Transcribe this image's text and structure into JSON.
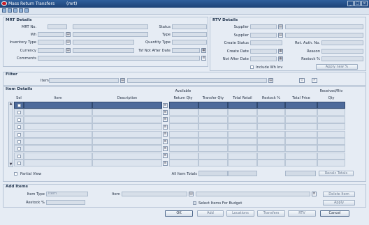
{
  "window": {
    "title": "Mass Return Transfers",
    "subtitle": "(mrt)",
    "min_glyph": "_",
    "max_glyph": "□",
    "close_glyph": "×"
  },
  "mrt_details": {
    "title": "MRT Details",
    "mrt_no_label": "MRT No.",
    "wh_label": "Wh",
    "inventory_type_label": "Inventory Type",
    "currency_label": "Currency",
    "comments_label": "Comments",
    "status_label": "Status",
    "type_label": "Type",
    "quantity_type_label": "Quantity Type",
    "tsf_not_after_date_label": "Tsf Not After Date"
  },
  "rtv_details": {
    "title": "RTV Details",
    "supplier_label_1": "Supplier",
    "supplier_label_2": "Supplier",
    "create_status_label": "Create Status",
    "create_date_label": "Create Date",
    "not_after_date_label": "Not After Date",
    "include_wh_inv_label": "Include Wh Inv",
    "ret_auth_no_label": "Ret. Auth. No.",
    "reason_label": "Reason",
    "restock_pct_label": "Restock %",
    "apply_new_pct_label": "Apply new %"
  },
  "filter": {
    "title": "Filter",
    "item_label": "Item"
  },
  "item_details": {
    "title": "Item Details",
    "columns": {
      "sel": "Sel",
      "item": "Item",
      "description": "Description",
      "available_return_qty_1": "Available",
      "available_return_qty_2": "Return Qty",
      "transfer_qty": "Transfer Qty",
      "total_retail": "Total Retail",
      "restock_pct": "Restock %",
      "total_price": "Total Price",
      "received_rtv_qty_1": "Received/Rtv",
      "received_rtv_qty_2": "Qty"
    },
    "partial_view_label": "Partial View",
    "all_item_totals_label": "All Item Totals",
    "recalc_totals_label": "Recalc Totals"
  },
  "add_items": {
    "title": "Add Items",
    "item_type_label": "Item Type",
    "item_type_value": "Item",
    "item_label": "Item",
    "restock_pct_label": "Restock %",
    "select_items_budget_label": "Select Items For Budget",
    "delete_item_label": "Delete Item",
    "apply_label": "Apply"
  },
  "footer": {
    "ok_label": "OK",
    "add_label": "Add",
    "locations_label": "Locations",
    "transfers_label": "Transfers",
    "rtv_label": "RTV",
    "cancel_label": "Cancel"
  },
  "colors": {
    "titlebar": "#2f5f9c",
    "selected_row": "#4d6a9a",
    "panel": "#e6ecf4"
  }
}
